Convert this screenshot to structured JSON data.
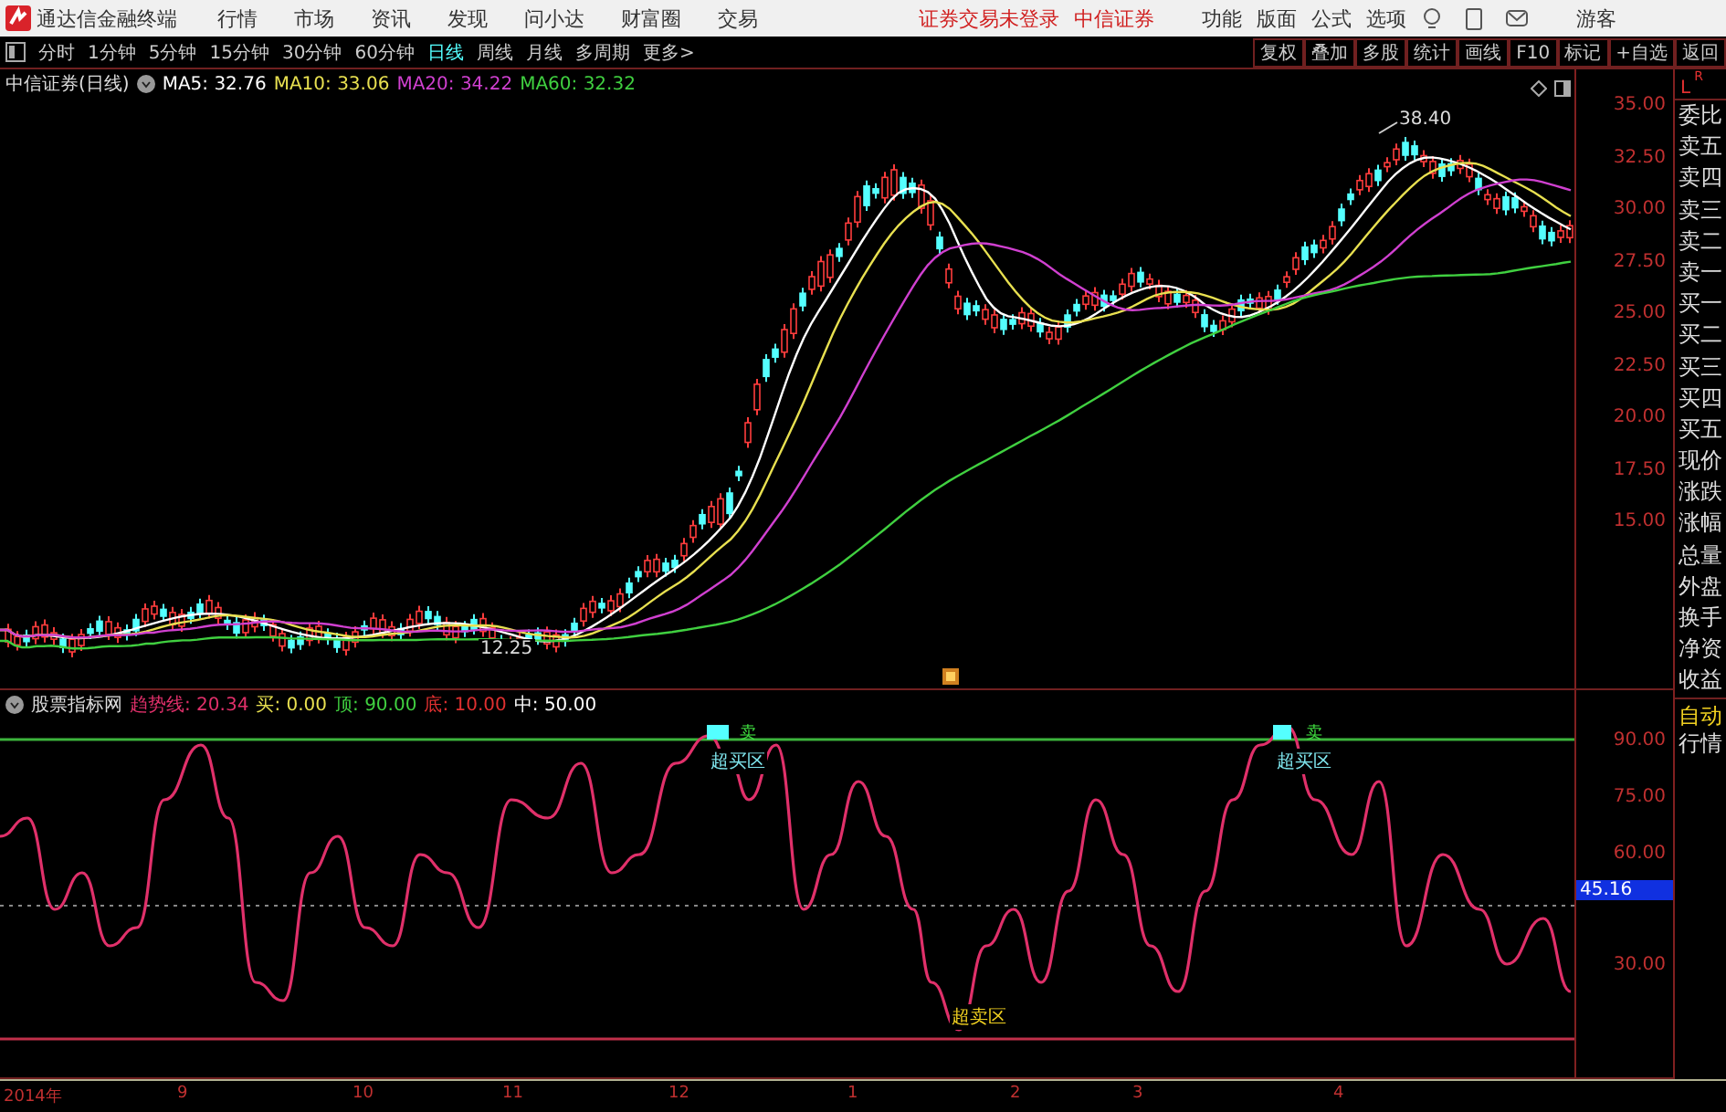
{
  "app_bar": {
    "app_title": "通达信金融终端",
    "menu": [
      "行情",
      "市场",
      "资讯",
      "发现",
      "问小达",
      "财富圈",
      "交易"
    ],
    "trade_status": "证券交易未登录",
    "broker": "中信证券",
    "tools": [
      "功能",
      "版面",
      "公式",
      "选项"
    ],
    "user": "游客"
  },
  "period_bar": {
    "periods": [
      {
        "label": "分时",
        "selected": false
      },
      {
        "label": "1分钟",
        "selected": false
      },
      {
        "label": "5分钟",
        "selected": false
      },
      {
        "label": "15分钟",
        "selected": false
      },
      {
        "label": "30分钟",
        "selected": false
      },
      {
        "label": "60分钟",
        "selected": false
      },
      {
        "label": "日线",
        "selected": true
      },
      {
        "label": "周线",
        "selected": false
      },
      {
        "label": "月线",
        "selected": false
      },
      {
        "label": "多周期",
        "selected": false
      },
      {
        "label": "更多>",
        "selected": false
      }
    ],
    "actions": [
      "复权",
      "叠加",
      "多股",
      "统计",
      "画线",
      "F10",
      "标记",
      "+自选",
      "返回"
    ]
  },
  "price_chart": {
    "title": "中信证券(日线)",
    "moving_averages": [
      {
        "label": "MA5: 32.76",
        "color": "#ffffff"
      },
      {
        "label": "MA10: 33.06",
        "color": "#e8e050"
      },
      {
        "label": "MA20: 34.22",
        "color": "#d040d0"
      },
      {
        "label": "MA60: 32.32",
        "color": "#40d040"
      }
    ],
    "y_axis_labels": [
      "35.00",
      "32.50",
      "30.00",
      "27.50",
      "25.00",
      "22.50",
      "20.00",
      "17.50",
      "15.00"
    ],
    "high_label": "38.40",
    "low_label": "12.25"
  },
  "indicator": {
    "name": "股票指标网",
    "readouts": [
      {
        "label": "趋势线: 20.34",
        "color": "#e0306a"
      },
      {
        "label": "买: 0.00",
        "color": "#e8e050"
      },
      {
        "label": "顶: 90.00",
        "color": "#40d040"
      },
      {
        "label": "底: 10.00",
        "color": "#e03030"
      },
      {
        "label": "中: 50.00",
        "color": "#ffffff"
      }
    ],
    "overbought_labels": [
      "超买区",
      "超买区"
    ],
    "sell_marks": [
      "卖",
      "卖"
    ],
    "oversold_label": "超卖区",
    "y_axis_labels": [
      "90.00",
      "75.00",
      "60.00",
      "30.00"
    ],
    "current_value": "45.16"
  },
  "quote_panel": {
    "corner": [
      "L",
      "R"
    ],
    "fields": [
      "委比",
      "卖五",
      "卖四",
      "卖三",
      "卖二",
      "卖一",
      "买一",
      "买二",
      "买三",
      "买四",
      "买五",
      "现价",
      "涨跌",
      "涨幅",
      "总量",
      "外盘",
      "换手",
      "净资",
      "收益"
    ],
    "footer": [
      "自动",
      "行情"
    ]
  },
  "time_axis": {
    "labels": [
      "2014年",
      "9",
      "10",
      "11",
      "12",
      "1",
      "2",
      "3",
      "4"
    ]
  }
}
